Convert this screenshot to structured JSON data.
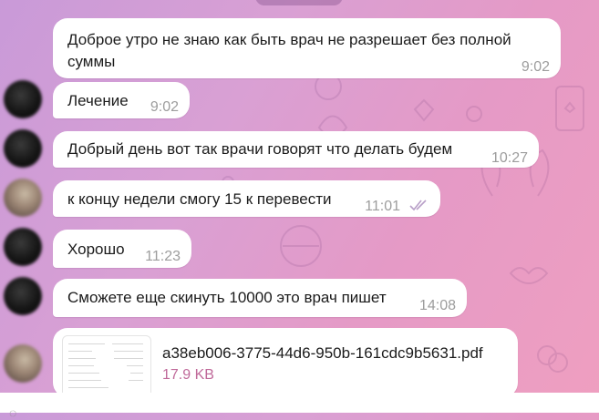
{
  "chat": {
    "messages": [
      {
        "text_line1": "Доброе утро не знаю как быть врач не разрешает без полной",
        "text_line2": "суммы",
        "time": "9:02"
      },
      {
        "text": "Лечение",
        "time": "9:02"
      },
      {
        "text": "Добрый день вот так врачи говорят что делать будем",
        "time": "10:27"
      },
      {
        "text": "к концу недели смогу 15 к перевести",
        "time": "11:01",
        "status": "read",
        "status_icon": "double-check-icon"
      },
      {
        "text": "Хорошо",
        "time": "11:23"
      },
      {
        "text": "Сможете еще скинуть 10000 это врач пишет",
        "time": "14:08"
      }
    ],
    "file": {
      "name": "a38eb006-3775-44d6-950b-161cdc9b5631.pdf",
      "size": "17.9 KB",
      "icon": "pdf-thumbnail"
    }
  },
  "colors": {
    "bubble": "#ffffff",
    "time": "#9d9d9d",
    "file_size": "#c06a9a",
    "read_check": "#b8a0c8"
  }
}
